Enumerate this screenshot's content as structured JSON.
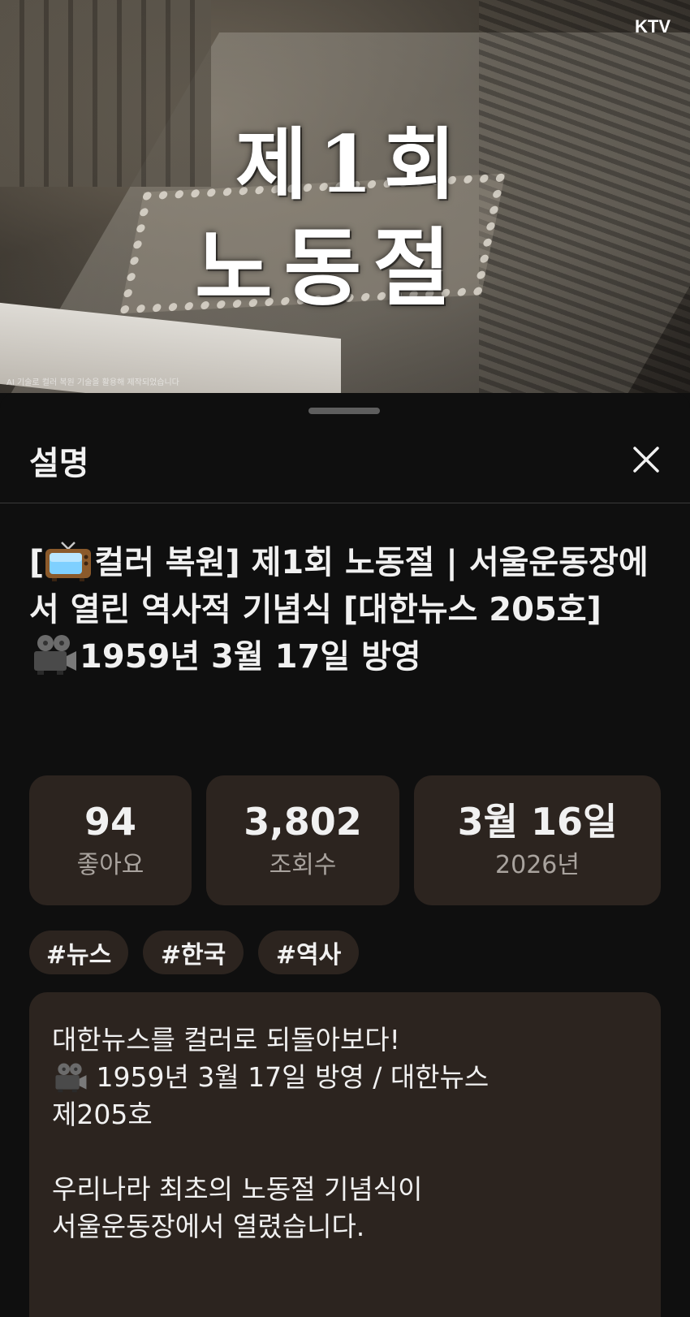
{
  "video": {
    "overlay_title_line1": "제1회",
    "overlay_title_line2": "노동절",
    "channel_watermark": "KTV",
    "ai_note": "AI 기술로 컬러 복원 기술을 활용해 제작되었습니다"
  },
  "sheet": {
    "title": "설명",
    "close_icon": "close-icon"
  },
  "title": {
    "tv_icon": "tv-emoji-icon",
    "part1": "컬러 복원] 제1회 노동절 | 서울운동장에서 열린 역사적 기념식 [대한뉴스 205호] ",
    "bracket_open": "[",
    "camera_icon": "film-projector-emoji-icon",
    "part2": "1959년 3월 17일 방영"
  },
  "stats": {
    "likes_value": "94",
    "likes_label": "좋아요",
    "views_value": "3,802",
    "views_label": "조회수",
    "date_value": "3월 16일",
    "date_label": "2026년"
  },
  "tags": [
    "#뉴스",
    "#한국",
    "#역사"
  ],
  "description": {
    "line1": "대한뉴스를 컬러로 되돌아보다!",
    "camera_icon": "film-projector-emoji-icon",
    "line2": " 1959년 3월 17일 방영 / 대한뉴스\n제205호",
    "line3": "우리나라 최초의 노동절 기념식이\n서울운동장에서 열렸습니다."
  },
  "colors": {
    "background": "#0f0f0f",
    "card": "#2c241f",
    "text_primary": "#f1f1f1",
    "text_secondary": "#a9a39e"
  }
}
